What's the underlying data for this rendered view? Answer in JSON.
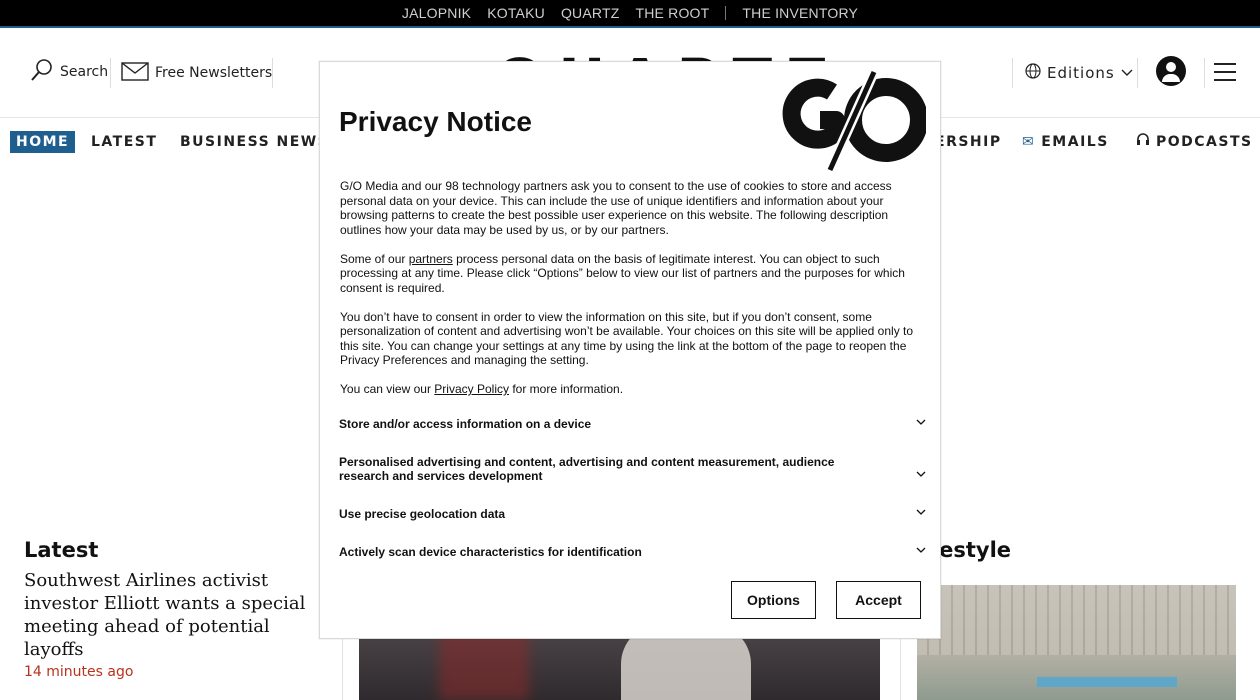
{
  "network_bar": {
    "sites": [
      "JALOPNIK",
      "KOTAKU",
      "QUARTZ",
      "THE ROOT"
    ],
    "extra_site": "THE INVENTORY"
  },
  "header": {
    "search_label": "Search",
    "newsletters_label": "Free Newsletters",
    "logo_text": "QUARTZ",
    "editions_label": "Editions"
  },
  "nav": {
    "items": [
      "HOME",
      "LATEST",
      "BUSINESS NEWS",
      "ERSHIP",
      "EMAILS",
      "PODCASTS"
    ]
  },
  "sections": {
    "latest_title": "Latest",
    "lifestyle_title": "festyle"
  },
  "story": {
    "title": "Southwest Airlines activist investor Elliott wants a special meeting ahead of potential layoffs",
    "time": "14 minutes ago"
  },
  "privacy": {
    "title": "Privacy Notice",
    "logo_text": "G/O",
    "p1": "G/O Media and our 98 technology partners ask you to consent to the use of cookies to store and access personal data on your device. This can include the use of unique identifiers and information about your browsing patterns to create the best possible user experience on this website. The following description outlines how your data may be used by us, or by our partners.",
    "p2_before": "Some of our ",
    "p2_link": "partners",
    "p2_after": " process personal data on the basis of legitimate interest. You can object to such processing at any time. Please click “Options” below to view our list of partners and the purposes for which consent is required.",
    "p3": "You don’t have to consent in order to view the information on this site, but if you don’t consent, some personalization of content and advertising won’t be available. Your choices on this site will be applied only to this site. You can change your settings at any time by using the link at the bottom of the page to reopen the Privacy Preferences and managing the setting.",
    "p4_before": "You can view our ",
    "p4_link": "Privacy Policy",
    "p4_after": " for more information.",
    "purposes": [
      "Store and/or access information on a device",
      "Personalised advertising and content, advertising and content measurement, audience research and services development",
      "Use precise geolocation data",
      "Actively scan device characteristics for identification"
    ],
    "options_button": "Options",
    "accept_button": "Accept"
  },
  "colors": {
    "nav_active_bg": "#1f5f8f",
    "time_red": "#b8321e",
    "network_bar_bg": "#000000"
  },
  "icons": {
    "search": "search-icon",
    "newsletter": "envelope-icon",
    "editions": "globe-icon",
    "user": "user-icon",
    "menu": "hamburger-icon",
    "emails": "envelope-icon",
    "podcasts": "headphones-icon",
    "chevron": "chevron-down-icon"
  }
}
